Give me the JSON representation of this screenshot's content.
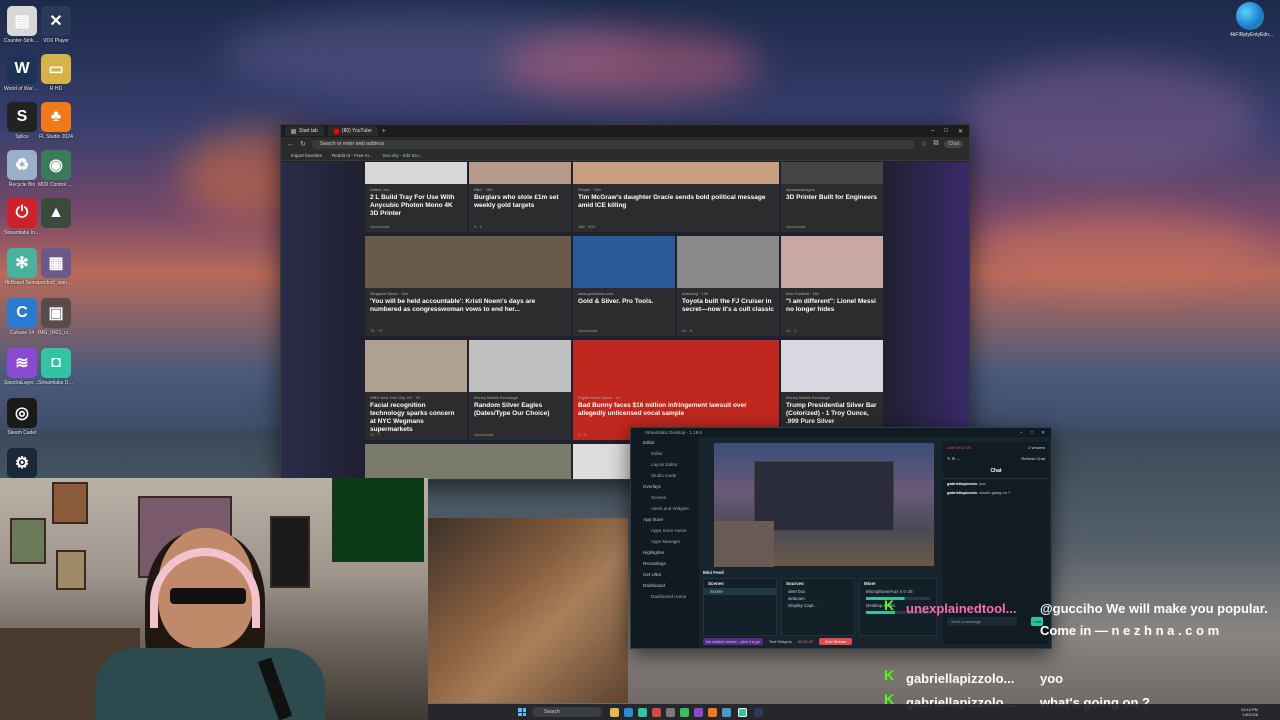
{
  "desktop": {
    "icons": [
      {
        "label": "Counter-Strike 2",
        "icon": "document-icon",
        "color": "#d8d8d8"
      },
      {
        "label": "VDX Player",
        "icon": "x-app-icon",
        "color": "#2a3a5a"
      },
      {
        "label": "World of Warcraft",
        "icon": "warcraft-icon",
        "color": "#1d3355"
      },
      {
        "label": "R HD",
        "icon": "folder-icon",
        "color": "#d6b24a"
      },
      {
        "label": "Splice",
        "icon": "splice-icon",
        "color": "#222222"
      },
      {
        "label": "FL Studio 2024",
        "icon": "fruity-loops-icon",
        "color": "#f07a1a"
      },
      {
        "label": "Recycle Bin",
        "icon": "recycle-bin-icon",
        "color": "#9ab0c8"
      },
      {
        "label": "MIDI Control Center",
        "icon": "midi-icon",
        "color": "#3b7a5a"
      },
      {
        "label": "Streamlabs Intel",
        "icon": "record-icon",
        "color": "#d0202c"
      },
      {
        "label": "",
        "icon": "tree-image-icon",
        "color": "#3a4a3a"
      },
      {
        "label": "HitBoard Series",
        "icon": "network-icon",
        "color": "#4ab0a0"
      },
      {
        "label": "product_stand_ad...",
        "icon": "image-file-icon",
        "color": "#6a5a8a"
      },
      {
        "label": "Cubase 14",
        "icon": "cubase-icon",
        "color": "#2a7ad0"
      },
      {
        "label": "IMG_0421_crope...",
        "icon": "photo-file-icon",
        "color": "#5a4a4a"
      },
      {
        "label": "SpectraLayers 11",
        "icon": "layers-icon",
        "color": "#8a4ad0"
      },
      {
        "label": "Streamlabs Desktop",
        "icon": "streamlabs-icon",
        "color": "#31c3a2"
      },
      {
        "label": "Steam Cadet",
        "icon": "steam-cadet-icon",
        "color": "#1a1a1a"
      },
      {
        "label": "",
        "icon": "steam-icon",
        "color": "#1b2838"
      }
    ],
    "edge_label": "4kFIRptyEntyEdn..."
  },
  "browser": {
    "tabs": [
      {
        "label": "Start tab",
        "color": "#888888"
      },
      {
        "label": "(80) YouTube",
        "color": "#ff0000"
      }
    ],
    "url_placeholder": "Search or enter web address",
    "favorites": [
      "Import favorites",
      "Reddit AI - Free AI...",
      "Security - Edit Bro..."
    ],
    "profile": "Chat",
    "cards": [
      {
        "source": "Dalles, Inc.",
        "title": "2 L Build Tray For Use With Anycubic Photon Mono 4K 3D Printer",
        "foot": "Sponsored"
      },
      {
        "source": "BBC · 10h",
        "title": "Burglars who stole £1m set weekly gold targets",
        "foot": "9 · 2"
      },
      {
        "source": "People · 10h",
        "title": "Tim McGraw's daughter Gracie sends bold political message amid ICE killing",
        "foot": "488 · 904"
      },
      {
        "source": "dynamicdesigns",
        "title": "3D Printer Built for Engineers",
        "foot": "Sponsored"
      },
      {
        "source": "Slingshot News · 14h",
        "title": "'You will be held accountable': Kristi Noem's days are numbered as congresswoman vows to end her...",
        "foot": "76 · 79"
      },
      {
        "source": "www.goldsilver.com",
        "title": "Gold & Silver. Pro Tools.",
        "foot": "Sponsored"
      },
      {
        "source": "Autoblog · 13h",
        "title": "Toyota built the FJ Cruiser in secret—now it's a cult classic",
        "foot": "40 · 9"
      },
      {
        "source": "Kick Football · 16h",
        "title": "\"I am different\": Lionel Messi no longer hides",
        "foot": "16 · 1"
      },
      {
        "source": "WBS New York City, NY · 2h",
        "title": "Facial recognition technology sparks concern at NYC Wegmans supermarkets",
        "foot": "72 · 7"
      },
      {
        "source": "Money Metals Exchange",
        "title": "Random Silver Eagles (Dates/Type Our Choice)",
        "foot": "Sponsored"
      },
      {
        "source": "Digital Music News · 1h",
        "title": "Bad Bunny faces $16 million infringement lawsuit over allegedly unlicensed vocal sample",
        "foot": "6 · 0"
      },
      {
        "source": "Money Metals Exchange",
        "title": "Trump Presidential Silver Bar (Colorized) - 1 Troy Ounce, .999 Pure Silver",
        "foot": "Sponsored"
      },
      {
        "source": "",
        "title": "...ent where audience is the animal",
        "foot": ""
      },
      {
        "source": "",
        "title": "3D Printers for P...",
        "foot": ""
      }
    ],
    "badge": "Refresh feed"
  },
  "streamlabs": {
    "title": "Streamlabs Desktop - 1.19.6",
    "nav": [
      {
        "label": "Editor",
        "sub": false
      },
      {
        "label": "Editor",
        "sub": true
      },
      {
        "label": "Layout Editor",
        "sub": true
      },
      {
        "label": "Studio mode",
        "sub": true
      },
      {
        "label": "Overlays",
        "sub": false
      },
      {
        "label": "Scenes",
        "sub": true
      },
      {
        "label": "Alerts and Widgets",
        "sub": true
      },
      {
        "label": "App Store",
        "sub": false
      },
      {
        "label": "Apps Store Home",
        "sub": true
      },
      {
        "label": "Apps Manager",
        "sub": true
      },
      {
        "label": "Highlighter",
        "sub": false
      },
      {
        "label": "Recordings",
        "sub": false
      },
      {
        "label": "Get Ultra",
        "sub": false
      },
      {
        "label": "Dashboard",
        "sub": false
      },
      {
        "label": "Dashboard Home",
        "sub": true
      }
    ],
    "chat_status": "Live 00:02:20",
    "chat_viewers": "2 viewers",
    "chat_title": "Chat",
    "chat_refresh": "Refresh Chat",
    "chat_messages": [
      {
        "user": "gabriellapizzolo",
        "text": "yoo"
      },
      {
        "user": "gabriellapizzolo",
        "text": "what's going on ?"
      }
    ],
    "chat_input_placeholder": "Send a message",
    "chat_send": "Chat",
    "mini_feed": "Mini Feed",
    "scenes_title": "Scenes",
    "scene_items": [
      "Scene"
    ],
    "sources_title": "Sources",
    "source_items": [
      "alert box",
      "webcam",
      "Display Capt..."
    ],
    "mixer_title": "Mixer",
    "mixer_items": [
      "Microphone/Aux",
      "Desktop Audio"
    ],
    "mixer_level": "0.0 dB",
    "footer_info": "No default device - give it a go",
    "footer_test": "Test Widgets",
    "footer_time": "00:02:20",
    "go_live": "End Stream"
  },
  "chat_overlay": [
    {
      "user": "unexplainedtool...",
      "user_color": "#ff6ab0",
      "text": "@gucciho We will make you popular. Come in — n e z h n a . c o m"
    },
    {
      "user": "gabriellapizzolo...",
      "user_color": "#f5f5f5",
      "text": "yoo"
    },
    {
      "user": "gabriellapizzolo...",
      "user_color": "#f5f5f5",
      "text": "what's going on ?"
    }
  ],
  "taskbar": {
    "search_placeholder": "Search",
    "time": "10:43 PM",
    "date": "1/8/2026"
  }
}
